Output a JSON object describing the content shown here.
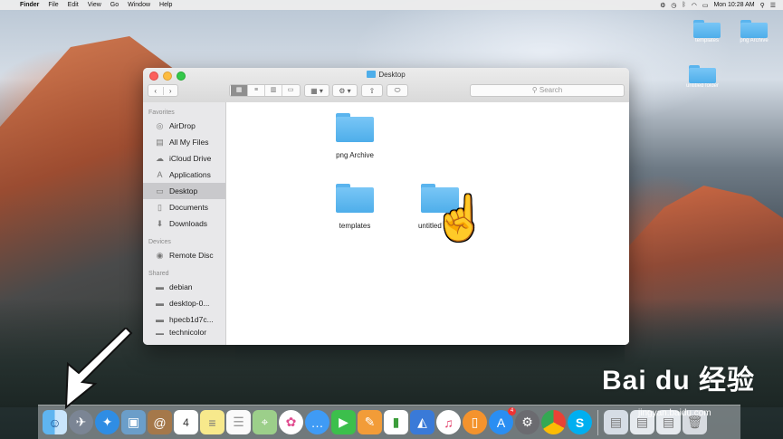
{
  "menubar": {
    "app": "Finder",
    "items": [
      "File",
      "Edit",
      "View",
      "Go",
      "Window",
      "Help"
    ],
    "clock": "Mon 10:28 AM"
  },
  "desktop_icons": [
    {
      "label": "templates"
    },
    {
      "label": "png Archive"
    },
    {
      "label": "untitled folder"
    }
  ],
  "window": {
    "title": "Desktop",
    "search_placeholder": "Search",
    "sidebar": {
      "favorites_header": "Favorites",
      "favorites": [
        {
          "label": "AirDrop",
          "icon": "airdrop-icon"
        },
        {
          "label": "All My Files",
          "icon": "all-files-icon"
        },
        {
          "label": "iCloud Drive",
          "icon": "cloud-icon"
        },
        {
          "label": "Applications",
          "icon": "applications-icon"
        },
        {
          "label": "Desktop",
          "icon": "desktop-icon",
          "selected": true
        },
        {
          "label": "Documents",
          "icon": "documents-icon"
        },
        {
          "label": "Downloads",
          "icon": "downloads-icon"
        }
      ],
      "devices_header": "Devices",
      "devices": [
        {
          "label": "Remote Disc",
          "icon": "disc-icon"
        }
      ],
      "shared_header": "Shared",
      "shared": [
        {
          "label": "debian",
          "icon": "computer-icon"
        },
        {
          "label": "desktop-0...",
          "icon": "computer-icon"
        },
        {
          "label": "hpecb1d7c...",
          "icon": "computer-icon"
        },
        {
          "label": "technicolor",
          "icon": "computer-icon"
        }
      ]
    },
    "items": [
      {
        "label": "png Archive"
      },
      {
        "label": "templates"
      },
      {
        "label": "untitled folder"
      }
    ]
  },
  "dock": {
    "apps": [
      "Finder",
      "Launchpad",
      "Safari",
      "Preview",
      "Contacts",
      "Calendar",
      "Notes",
      "Reminders",
      "Maps",
      "Photos",
      "Messages",
      "FaceTime",
      "Pages",
      "Numbers",
      "Keynote",
      "iTunes",
      "iBooks",
      "App Store",
      "System Preferences",
      "Chrome",
      "Skype"
    ],
    "calendar_day": "4",
    "appstore_badge": "4"
  },
  "watermark": {
    "brand": "Bai du 经验",
    "url": "jingyan.baidu.com"
  },
  "colors": {
    "folder": "#4eaeea",
    "selection": "#c9c9cc"
  }
}
